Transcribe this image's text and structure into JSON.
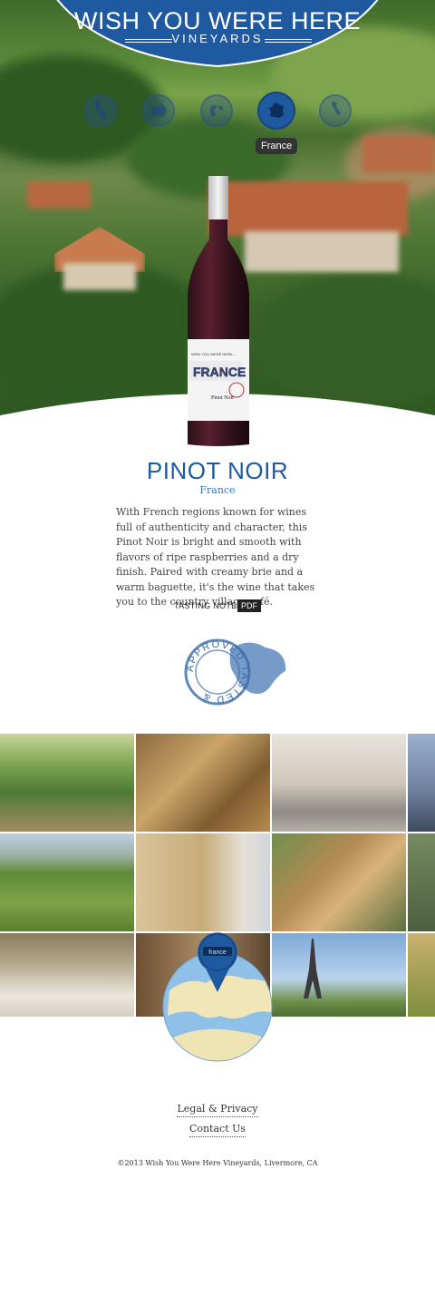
{
  "brand": {
    "title": "WISH YOU WERE HERE",
    "subtitle": "VINEYARDS"
  },
  "region_nav": {
    "items": [
      {
        "icon": "california-icon"
      },
      {
        "icon": "australia-icon"
      },
      {
        "icon": "globe-icon"
      },
      {
        "icon": "france-icon",
        "active": true
      },
      {
        "icon": "italy-icon"
      }
    ],
    "active_tooltip": "France"
  },
  "bottle_label": {
    "top": "WISH YOU WERE HERE...",
    "art": "FRANCE",
    "varietal": "Pinot Noir"
  },
  "product": {
    "name": "PINOT NOIR",
    "country": "France",
    "description": "With French regions known for wines full of authenticity and character, this Pinot Noir is bright and smooth with flavors of ripe raspberries and a dry finish. Paired with creamy brie and a warm baguette, it's the wine that takes you to the country village café.",
    "tasting_notes_label": "TASTING NOTES",
    "pdf_label": "PDF"
  },
  "stamp": {
    "text": "APPROVED TASTED &"
  },
  "map_pin": {
    "label": "france"
  },
  "footer": {
    "legal": "Legal & Privacy",
    "contact": "Contact Us",
    "copyright": "©2013 Wish You Were Here Vineyards, Livermore, CA"
  },
  "colors": {
    "brand_blue": "#1f5aa0",
    "accent_blue": "#3a78bd",
    "text": "#444444"
  }
}
